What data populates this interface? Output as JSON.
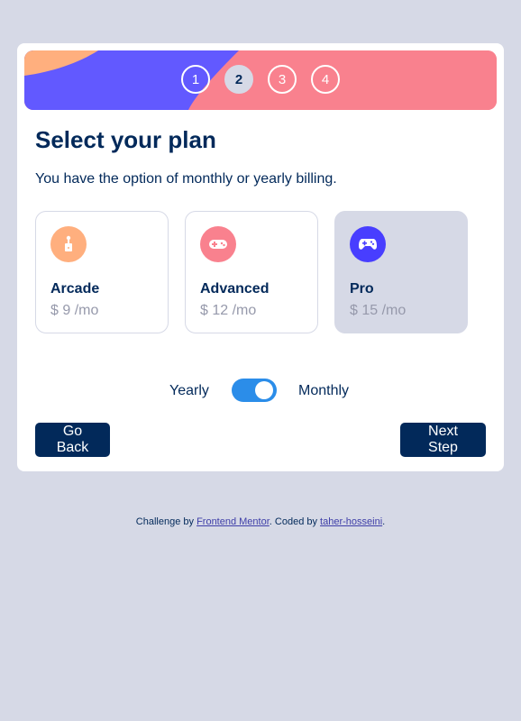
{
  "steps": [
    "1",
    "2",
    "3",
    "4"
  ],
  "active_step": "2",
  "title": "Select your plan",
  "subtitle": "You have the option of monthly or yearly billing.",
  "plans": [
    {
      "name": "Arcade",
      "price": "$ 9 /mo",
      "icon": "joystick-icon",
      "color": "#ffaf7e"
    },
    {
      "name": "Advanced",
      "price": "$ 12 /mo",
      "icon": "gamepad-icon",
      "color": "#f9818e"
    },
    {
      "name": "Pro",
      "price": "$ 15 /mo",
      "icon": "controller-icon",
      "color": "#483eff"
    }
  ],
  "selected_plan": "Pro",
  "billing": {
    "yearly_label": "Yearly",
    "monthly_label": "Monthly",
    "toggle_on": true
  },
  "buttons": {
    "back": "Go Back",
    "next": "Next Step"
  },
  "footer": {
    "prefix": "Challenge by ",
    "link1": "Frontend Mentor",
    "middle": ". Coded by ",
    "link2": "taher-hosseini",
    "suffix": "."
  },
  "colors": {
    "background": "#d6d9e6",
    "primary": "#02295a",
    "accent_blue": "#2b8de9",
    "banner_purple": "#6259ff",
    "banner_pink": "#f9818e",
    "banner_orange": "#ffaf7e"
  }
}
